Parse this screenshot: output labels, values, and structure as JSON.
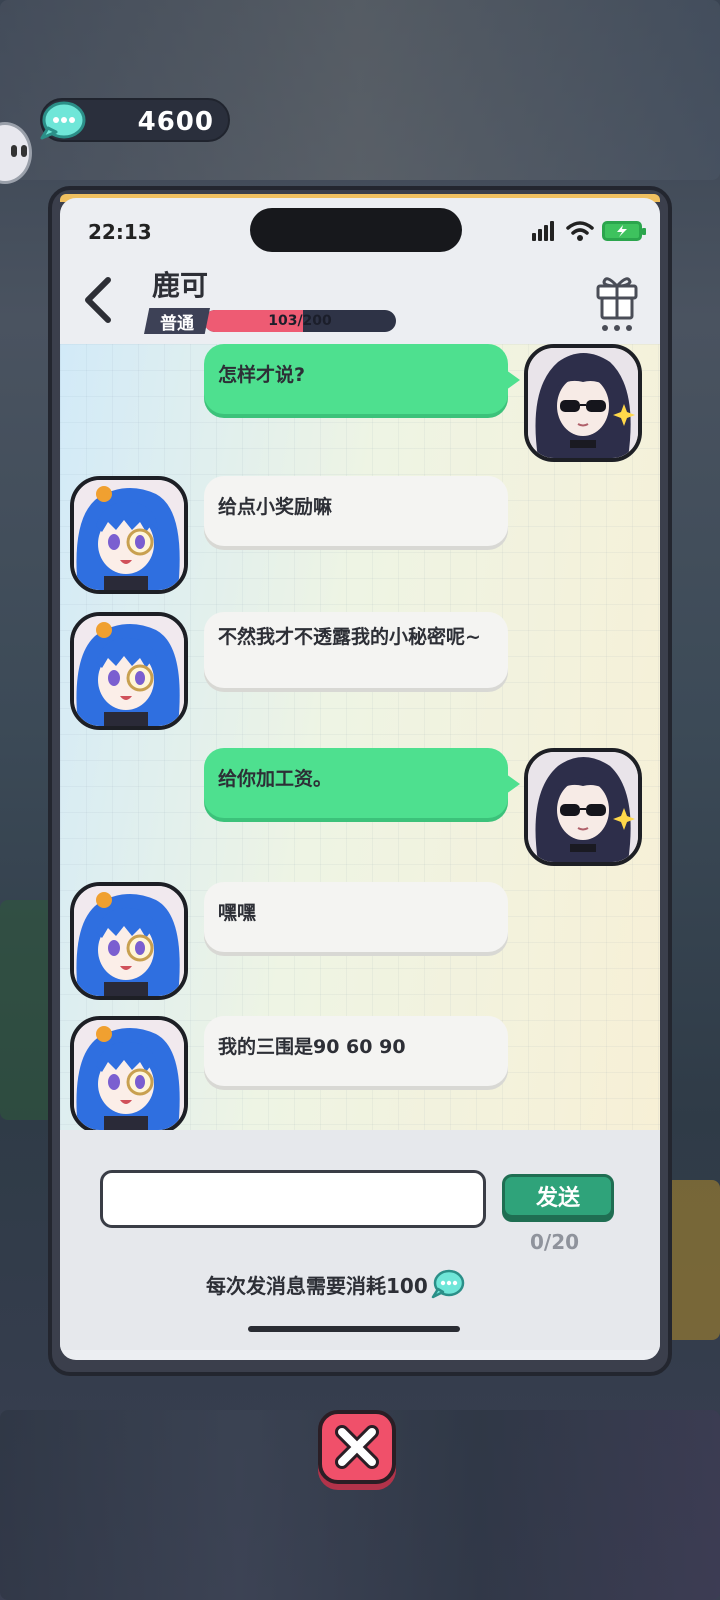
{
  "top_bar": {
    "currency_amount": "4600"
  },
  "status_bar": {
    "time": "22:13"
  },
  "header": {
    "contact_name": "鹿可",
    "rank": "普通",
    "affinity": {
      "current": 103,
      "max": 200,
      "text": "103/200",
      "fraction": 0.515
    }
  },
  "messages": [
    {
      "from": "me",
      "text": "怎样才说?"
    },
    {
      "from": "them",
      "text": "给点小奖励嘛"
    },
    {
      "from": "them",
      "text": "不然我才不透露我的小秘密呢~"
    },
    {
      "from": "me",
      "text": "给你加工资。"
    },
    {
      "from": "them",
      "text": "嘿嘿"
    },
    {
      "from": "them",
      "text": "我的三围是90 60 90"
    }
  ],
  "composer": {
    "input_value": "",
    "send_label": "发送",
    "char_count": "0/20",
    "cost_note": "每次发消息需要消耗100"
  },
  "colors": {
    "my_bubble": "#4ee08f",
    "their_bubble": "#f4f4f2",
    "send_button": "#2fa37a",
    "close_button": "#f0506a",
    "xp_fill": "#ee5b73"
  },
  "icons": [
    "chat-coin-icon",
    "back-arrow-icon",
    "gift-icon",
    "signal-icon",
    "wifi-icon",
    "battery-icon",
    "close-icon"
  ]
}
